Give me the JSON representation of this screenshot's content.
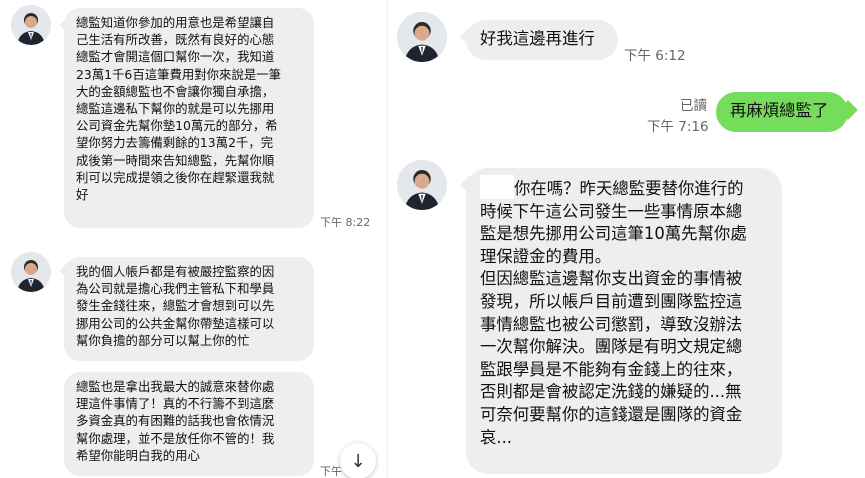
{
  "left_chat": {
    "messages": [
      {
        "lines": [
          "總監知道你參加的用意也是希望讓自",
          "己生活有所改善，既然有良好的心態",
          "總監才會開這個口幫你一次，我知道",
          "23萬1千6百這筆費用對你來說是一筆",
          "大的金額總監也不會讓你獨自承擔，",
          "總監這邊私下幫你的就是可以先挪用",
          "公司資金先幫你墊10萬元的部分，希",
          "望你努力去籌備剩餘的13萬2千，完",
          "成後第一時間來告知總監，先幫你順",
          "利可以完成提領之後你在趕緊還我就",
          "好"
        ],
        "time": "下午 8:22"
      },
      {
        "lines": [
          "我的個人帳戶都是有被嚴控監察的因",
          "為公司就是擔心我們主管私下和學員",
          "發生金錢往來，總監才會想到可以先",
          "挪用公司的公共金幫你帶墊這樣可以",
          "幫你負擔的部分可以幫上你的忙"
        ],
        "time": ""
      },
      {
        "lines": [
          "總監也是拿出我最大的誠意來替你處",
          "理這件事情了！真的不行籌不到這麼",
          "多資金真的有困難的話我也會依情況",
          "幫你處理，並不是放任你不管的！我",
          "希望你能明白我的用心"
        ],
        "time": "下午"
      }
    ],
    "scroll_icon": "↓"
  },
  "right_chat": {
    "msg1": {
      "text": "好我這邊再進行",
      "time": "下午 6:12"
    },
    "msg2": {
      "text": "再麻煩總監了",
      "read": "已讀",
      "time": "下午 7:16"
    },
    "msg3": {
      "lines": [
        "你在嗎？昨天總監要替你進行的",
        "時候下午這公司發生一些事情原本總",
        "監是想先挪用公司這筆10萬先幫你處",
        "理保證金的費用。",
        "但因總監這邊幫你支出資金的事情被",
        "發現，所以帳戶目前遭到團隊監控這",
        "事情總監也被公司懲罰，導致沒辦法",
        "一次幫你解決。團隊是有明文規定總",
        "監跟學員是不能夠有金錢上的往來，",
        "否則都是會被認定洗錢的嫌疑的...無",
        "可奈何要幫你的這錢還是團隊的資金",
        "哀..."
      ]
    }
  },
  "colors": {
    "incoming_bubble": "#eeeeee",
    "outgoing_bubble": "#76dc5c"
  },
  "icons": {
    "avatar": "person-avatar-icon",
    "scroll": "arrow-down-icon"
  }
}
